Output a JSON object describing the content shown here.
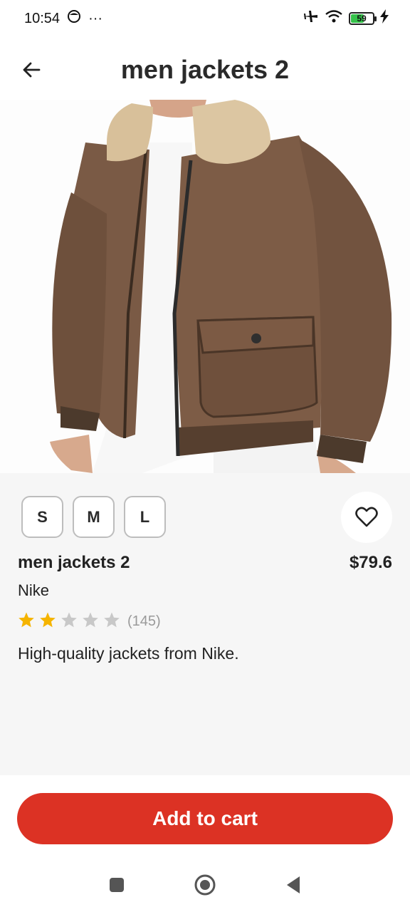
{
  "status": {
    "time": "10:54",
    "more": "···",
    "battery": "59",
    "battery_level": 0.59
  },
  "header": {
    "title": "men jackets 2"
  },
  "product": {
    "image_alt": "brown suede jacket with shearling collar",
    "sizes": [
      "S",
      "M",
      "L"
    ],
    "name": "men jackets 2",
    "price": "$79.6",
    "brand": "Nike",
    "rating": 2,
    "rating_max": 5,
    "rating_count": "(145)",
    "description": "High-quality jackets from Nike."
  },
  "actions": {
    "add_to_cart": "Add to cart"
  },
  "colors": {
    "accent": "#dc3224",
    "star_filled": "#f5b400",
    "star_empty": "#c8c8c8"
  }
}
